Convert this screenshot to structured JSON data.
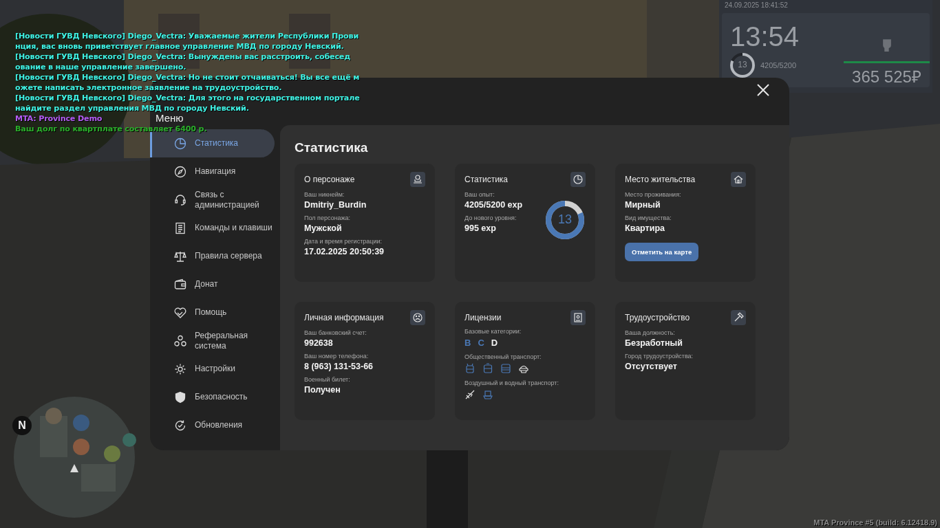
{
  "chat": [
    {
      "text": "[Новости ГУВД Невского] Diego_Vectra: Уважаемые жители Республики Прови",
      "color": "#3ff2e4"
    },
    {
      "text": "нция, вас вновь приветствует главное управление МВД по городу Невский.",
      "color": "#3ff2e4"
    },
    {
      "text": "[Новости ГУВД Невского] Diego_Vectra: Вынуждены вас расстроить, собесед",
      "color": "#3ff2e4"
    },
    {
      "text": "ование в наше управление завершено.",
      "color": "#3ff2e4"
    },
    {
      "text": "[Новости ГУВД Невского] Diego_Vectra: Но не стоит отчаиваться! Вы все ещё м",
      "color": "#3ff2e4"
    },
    {
      "text": "ожете написать электронное заявление на трудоустройство.",
      "color": "#3ff2e4"
    },
    {
      "text": "[Новости ГУВД Невского] Diego_Vectra: Для этого на государственном портале",
      "color": "#3ff2e4"
    },
    {
      "text": "найдите раздел управления МВД по городу Невский.",
      "color": "#3ff2e4"
    },
    {
      "text": "MTA: Province Demo",
      "color": "#b45cf5"
    },
    {
      "text": "Ваш долг по квартплате составляет 6400 р.",
      "color": "#2bb02b"
    }
  ],
  "hud": {
    "date": "24.09.2025 18:41:52",
    "time": "13:54",
    "level_text": "13",
    "exp": "4205/5200",
    "exp_ring": {
      "level": 0.81
    },
    "health": {
      "level": 1
    },
    "money": "365 525₽"
  },
  "minimap": {
    "north": "N"
  },
  "menu": {
    "title": "Меню",
    "sidebar": [
      {
        "label": "Статистика",
        "kind": "stats",
        "selected": true
      },
      {
        "label": "Навигация",
        "kind": "compass",
        "selected": false
      },
      {
        "label": "Связь с\nадминистрацией",
        "kind": "headset",
        "selected": false
      },
      {
        "label": "Команды и клавиши",
        "kind": "document",
        "selected": false
      },
      {
        "label": "Правила сервера",
        "kind": "scales",
        "selected": false
      },
      {
        "label": "Донат",
        "kind": "wallet",
        "selected": false
      },
      {
        "label": "Помощь",
        "kind": "heart",
        "selected": false
      },
      {
        "label": "Реферальная\nсистема",
        "kind": "people",
        "selected": false
      },
      {
        "label": "Настройки",
        "kind": "gear",
        "selected": false
      },
      {
        "label": "Безопасность",
        "kind": "shield",
        "selected": false
      },
      {
        "label": "Обновления",
        "kind": "refresh",
        "selected": false
      }
    ],
    "heading": "Статистика",
    "cards": [
      {
        "title": "О персонаже",
        "kind": "fields",
        "fields": [
          {
            "label": "Ваш никнейм:",
            "value": "Dmitriy_Burdin"
          },
          {
            "label": "Пол персонажа:",
            "value": "Мужской"
          },
          {
            "label": "Дата и время регистрации:",
            "value": "17.02.2025 20:50:39"
          }
        ]
      },
      {
        "title": "Статистика",
        "kind": "stats",
        "fields": [
          {
            "label": "Ваш опыт:",
            "value": "4205/5200 exp"
          },
          {
            "label": "До нового уровня:",
            "value": "995 exp"
          }
        ],
        "ring": {
          "label": "13",
          "level": 0.81
        }
      },
      {
        "title": "Место жительства",
        "kind": "residence",
        "fields": [
          {
            "label": "Место проживания:",
            "value": "Мирный"
          },
          {
            "label": "Вид имущества:",
            "value": "Квартира"
          }
        ],
        "button": "Отметить на карте"
      },
      {
        "title": "Личная информация",
        "kind": "fields",
        "fields": [
          {
            "label": "Ваш банковский счет:",
            "value": "992638"
          },
          {
            "label": "Ваш номер телефона:",
            "value": "8 (963) 131-53-66"
          },
          {
            "label": "Военный билет:",
            "value": "Получен"
          }
        ]
      },
      {
        "title": "Лицензии",
        "kind": "licenses",
        "sections": [
          {
            "label": "Базовые категории:",
            "kind": "letters",
            "items": [
              {
                "text": "B",
                "held": true
              },
              {
                "text": "C",
                "held": true
              },
              {
                "text": "D",
                "held": false
              }
            ]
          },
          {
            "label": "Общественный транспорт:",
            "kind": "icons",
            "items": [
              {
                "kind": "trolleybus",
                "held": true
              },
              {
                "kind": "tram",
                "held": true
              },
              {
                "kind": "bus",
                "held": true
              },
              {
                "kind": "taxi",
                "held": false
              }
            ]
          },
          {
            "label": "Воздушный и водный транспорт:",
            "kind": "icons",
            "items": [
              {
                "kind": "plane",
                "held": false
              },
              {
                "kind": "boat",
                "held": true
              }
            ]
          }
        ]
      },
      {
        "title": "Трудоустройство",
        "kind": "fields",
        "fields": [
          {
            "label": "Ваша должность:",
            "value": "Безработный"
          },
          {
            "label": "Город трудоустройства:",
            "value": "Отсутствует"
          }
        ]
      }
    ]
  },
  "footer": "MTA Province #5 (build: 6.12418.9)"
}
